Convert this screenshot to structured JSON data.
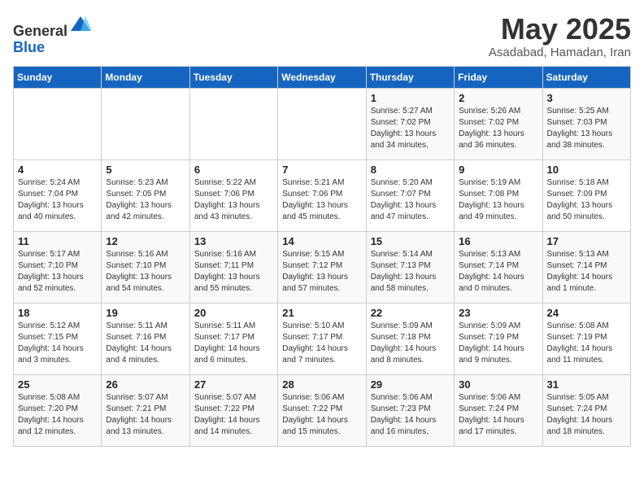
{
  "header": {
    "logo_line1": "General",
    "logo_line2": "Blue",
    "month": "May 2025",
    "location": "Asadabad, Hamadan, Iran"
  },
  "weekdays": [
    "Sunday",
    "Monday",
    "Tuesday",
    "Wednesday",
    "Thursday",
    "Friday",
    "Saturday"
  ],
  "weeks": [
    [
      {
        "day": "",
        "content": ""
      },
      {
        "day": "",
        "content": ""
      },
      {
        "day": "",
        "content": ""
      },
      {
        "day": "",
        "content": ""
      },
      {
        "day": "1",
        "content": "Sunrise: 5:27 AM\nSunset: 7:02 PM\nDaylight: 13 hours\nand 34 minutes."
      },
      {
        "day": "2",
        "content": "Sunrise: 5:26 AM\nSunset: 7:02 PM\nDaylight: 13 hours\nand 36 minutes."
      },
      {
        "day": "3",
        "content": "Sunrise: 5:25 AM\nSunset: 7:03 PM\nDaylight: 13 hours\nand 38 minutes."
      }
    ],
    [
      {
        "day": "4",
        "content": "Sunrise: 5:24 AM\nSunset: 7:04 PM\nDaylight: 13 hours\nand 40 minutes."
      },
      {
        "day": "5",
        "content": "Sunrise: 5:23 AM\nSunset: 7:05 PM\nDaylight: 13 hours\nand 42 minutes."
      },
      {
        "day": "6",
        "content": "Sunrise: 5:22 AM\nSunset: 7:06 PM\nDaylight: 13 hours\nand 43 minutes."
      },
      {
        "day": "7",
        "content": "Sunrise: 5:21 AM\nSunset: 7:06 PM\nDaylight: 13 hours\nand 45 minutes."
      },
      {
        "day": "8",
        "content": "Sunrise: 5:20 AM\nSunset: 7:07 PM\nDaylight: 13 hours\nand 47 minutes."
      },
      {
        "day": "9",
        "content": "Sunrise: 5:19 AM\nSunset: 7:08 PM\nDaylight: 13 hours\nand 49 minutes."
      },
      {
        "day": "10",
        "content": "Sunrise: 5:18 AM\nSunset: 7:09 PM\nDaylight: 13 hours\nand 50 minutes."
      }
    ],
    [
      {
        "day": "11",
        "content": "Sunrise: 5:17 AM\nSunset: 7:10 PM\nDaylight: 13 hours\nand 52 minutes."
      },
      {
        "day": "12",
        "content": "Sunrise: 5:16 AM\nSunset: 7:10 PM\nDaylight: 13 hours\nand 54 minutes."
      },
      {
        "day": "13",
        "content": "Sunrise: 5:16 AM\nSunset: 7:11 PM\nDaylight: 13 hours\nand 55 minutes."
      },
      {
        "day": "14",
        "content": "Sunrise: 5:15 AM\nSunset: 7:12 PM\nDaylight: 13 hours\nand 57 minutes."
      },
      {
        "day": "15",
        "content": "Sunrise: 5:14 AM\nSunset: 7:13 PM\nDaylight: 13 hours\nand 58 minutes."
      },
      {
        "day": "16",
        "content": "Sunrise: 5:13 AM\nSunset: 7:14 PM\nDaylight: 14 hours\nand 0 minutes."
      },
      {
        "day": "17",
        "content": "Sunrise: 5:13 AM\nSunset: 7:14 PM\nDaylight: 14 hours\nand 1 minute."
      }
    ],
    [
      {
        "day": "18",
        "content": "Sunrise: 5:12 AM\nSunset: 7:15 PM\nDaylight: 14 hours\nand 3 minutes."
      },
      {
        "day": "19",
        "content": "Sunrise: 5:11 AM\nSunset: 7:16 PM\nDaylight: 14 hours\nand 4 minutes."
      },
      {
        "day": "20",
        "content": "Sunrise: 5:11 AM\nSunset: 7:17 PM\nDaylight: 14 hours\nand 6 minutes."
      },
      {
        "day": "21",
        "content": "Sunrise: 5:10 AM\nSunset: 7:17 PM\nDaylight: 14 hours\nand 7 minutes."
      },
      {
        "day": "22",
        "content": "Sunrise: 5:09 AM\nSunset: 7:18 PM\nDaylight: 14 hours\nand 8 minutes."
      },
      {
        "day": "23",
        "content": "Sunrise: 5:09 AM\nSunset: 7:19 PM\nDaylight: 14 hours\nand 9 minutes."
      },
      {
        "day": "24",
        "content": "Sunrise: 5:08 AM\nSunset: 7:19 PM\nDaylight: 14 hours\nand 11 minutes."
      }
    ],
    [
      {
        "day": "25",
        "content": "Sunrise: 5:08 AM\nSunset: 7:20 PM\nDaylight: 14 hours\nand 12 minutes."
      },
      {
        "day": "26",
        "content": "Sunrise: 5:07 AM\nSunset: 7:21 PM\nDaylight: 14 hours\nand 13 minutes."
      },
      {
        "day": "27",
        "content": "Sunrise: 5:07 AM\nSunset: 7:22 PM\nDaylight: 14 hours\nand 14 minutes."
      },
      {
        "day": "28",
        "content": "Sunrise: 5:06 AM\nSunset: 7:22 PM\nDaylight: 14 hours\nand 15 minutes."
      },
      {
        "day": "29",
        "content": "Sunrise: 5:06 AM\nSunset: 7:23 PM\nDaylight: 14 hours\nand 16 minutes."
      },
      {
        "day": "30",
        "content": "Sunrise: 5:06 AM\nSunset: 7:24 PM\nDaylight: 14 hours\nand 17 minutes."
      },
      {
        "day": "31",
        "content": "Sunrise: 5:05 AM\nSunset: 7:24 PM\nDaylight: 14 hours\nand 18 minutes."
      }
    ]
  ]
}
